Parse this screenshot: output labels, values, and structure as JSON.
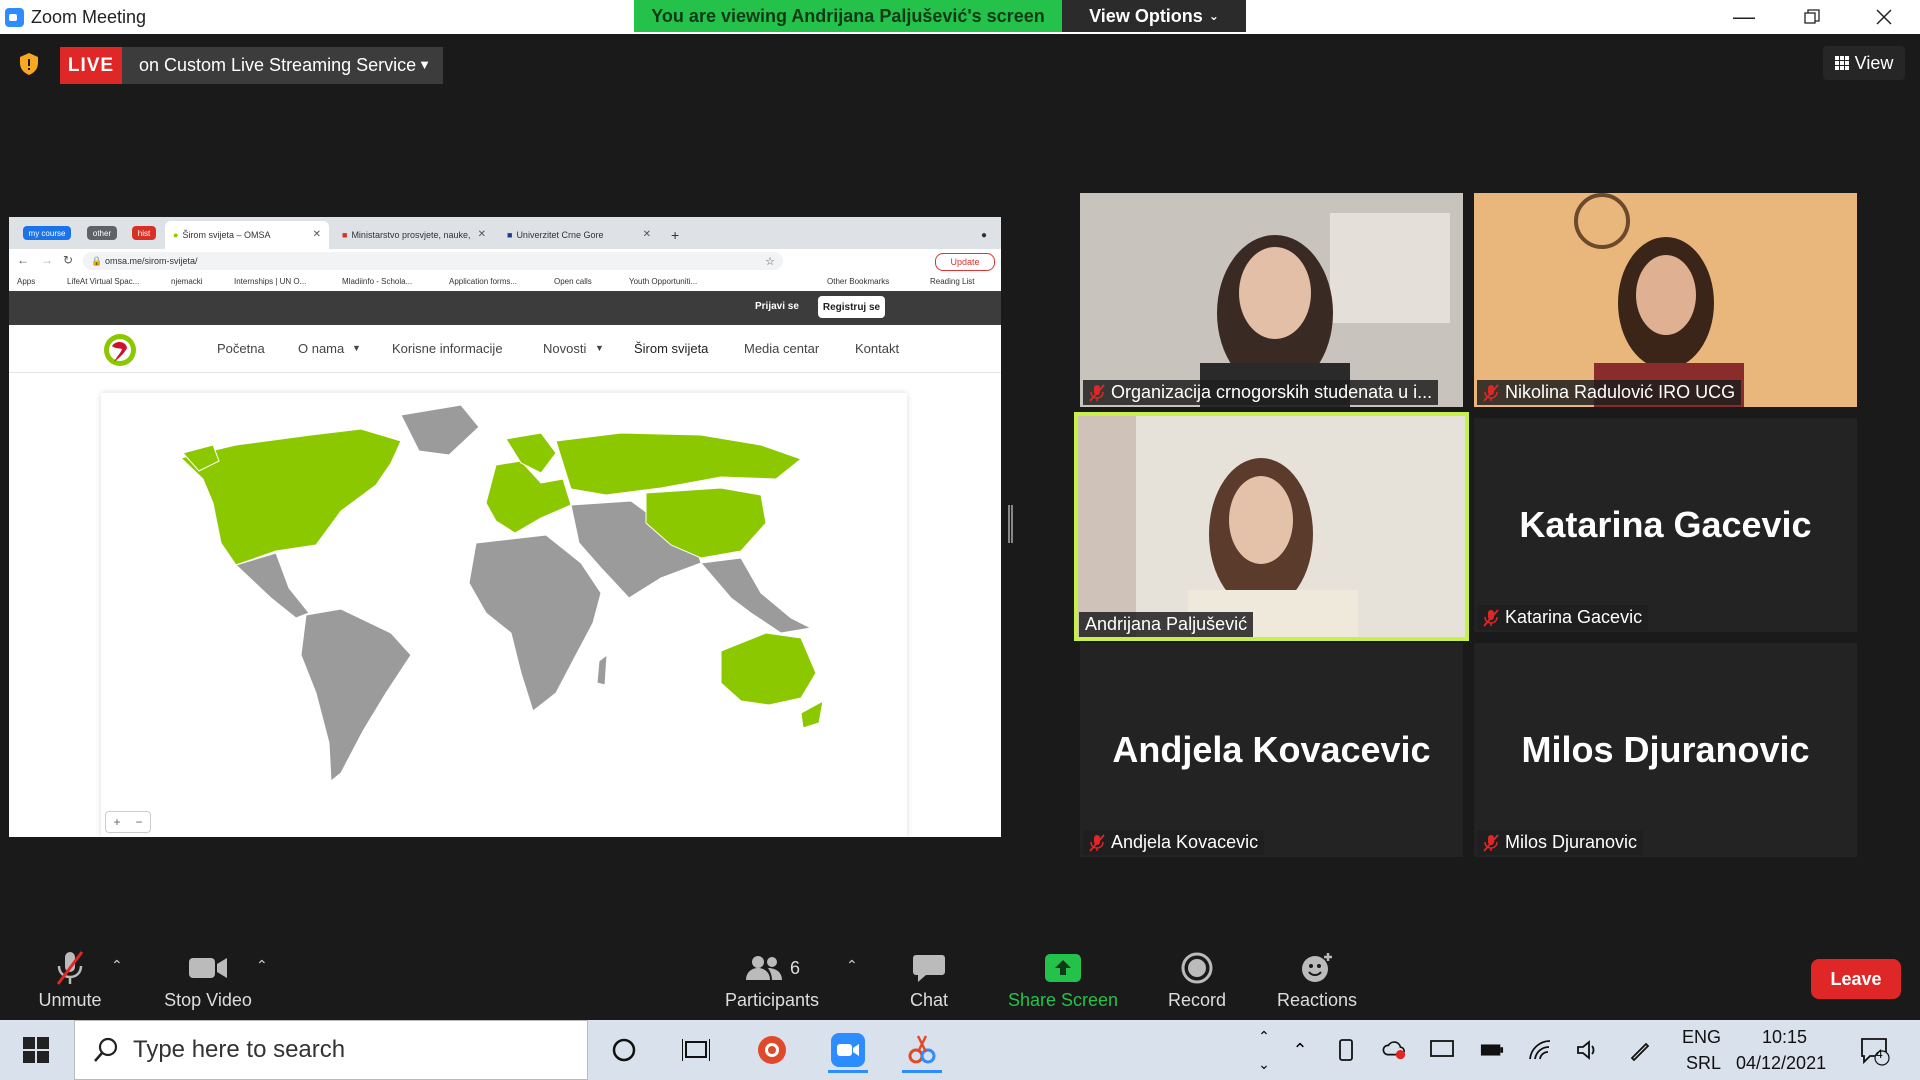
{
  "window": {
    "title": "Zoom Meeting"
  },
  "banner": {
    "viewing_text": "You are viewing Andrijana Paljušević's screen",
    "view_options": "View Options"
  },
  "live": {
    "badge": "LIVE",
    "service": "on Custom Live Streaming Service"
  },
  "view_button": "View",
  "shared_screen": {
    "tab_pills": [
      {
        "label": "my course",
        "color": "#1a73e8"
      },
      {
        "label": "other",
        "color": "#5f6368"
      },
      {
        "label": "hist",
        "color": "#d93025"
      }
    ],
    "tabs": [
      "Širom svijeta – OMSA",
      "Ministarstvo prosvjete, nauke,",
      "Univerzitet Crne Gore"
    ],
    "url": "omsa.me/sirom-svijeta/",
    "update_label": "Update",
    "bookmarks": [
      "Apps",
      "LifeAt Virtual Spac...",
      "njemacki",
      "Internships | UN O...",
      "Mladiinfo - Schola...",
      "Application forms...",
      "Open calls",
      "Youth Opportuniti..."
    ],
    "bookmarks_right": [
      "Other Bookmarks",
      "Reading List"
    ],
    "login": "Prijavi se",
    "register": "Registruj se",
    "nav": [
      "Početna",
      "O nama",
      "Korisne informacije",
      "Novosti",
      "Širom svijeta",
      "Media centar",
      "Kontakt"
    ],
    "map_colors": {
      "highlight": "#8cc800",
      "other": "#9b9b9b"
    }
  },
  "participants_tiles": [
    {
      "name": "Organizacija crnogorskih studenata u i...",
      "type": "video",
      "muted": true
    },
    {
      "name": "Nikolina Radulović IRO UCG",
      "type": "video",
      "muted": true
    },
    {
      "name": "Andrijana Paljušević",
      "type": "video",
      "muted": false,
      "active": true
    },
    {
      "name": "Katarina Gacevic",
      "type": "name",
      "big": "Katarina Gacevic",
      "muted": true
    },
    {
      "name": "Andjela Kovacevic",
      "type": "name",
      "big": "Andjela Kovacevic",
      "muted": true
    },
    {
      "name": "Milos Djuranovic",
      "type": "name",
      "big": "Milos Djuranovic",
      "muted": true
    }
  ],
  "toolbar": {
    "unmute": "Unmute",
    "stop_video": "Stop Video",
    "participants": "Participants",
    "participants_count": "6",
    "chat": "Chat",
    "share_screen": "Share Screen",
    "record": "Record",
    "reactions": "Reactions",
    "leave": "Leave"
  },
  "taskbar": {
    "search_placeholder": "Type here to search",
    "lang1": "ENG",
    "lang2": "SRL",
    "time": "10:15",
    "date": "04/12/2021",
    "notif_count": "4"
  }
}
